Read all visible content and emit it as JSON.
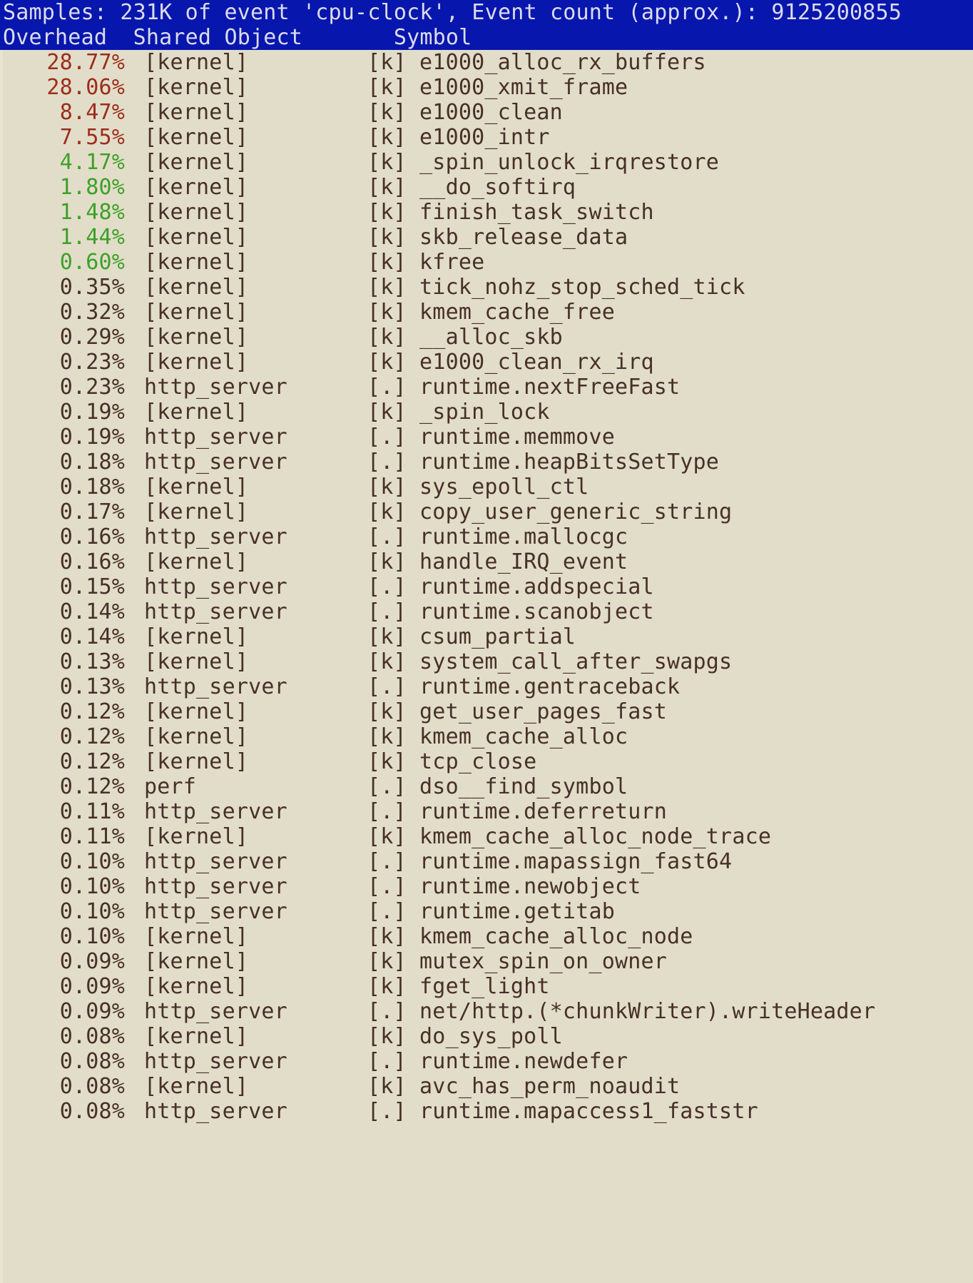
{
  "app": "perf report",
  "colors": {
    "background": "#e2ddc9",
    "foreground": "#473028",
    "header_background": "#0716ad",
    "header_foreground": "#dcdcec",
    "hot": "#9b2d1a",
    "warm": "#3da028"
  },
  "header": {
    "summary": "Samples: 231K of event 'cpu-clock', Event count (approx.): 9125200855",
    "samples": "231K",
    "event": "cpu-clock",
    "event_count": "9125200855",
    "columns": {
      "overhead": "Overhead",
      "shared_object": "Shared Object",
      "symbol": "Symbol"
    },
    "columns_line": "Overhead  Shared Object       Symbol"
  },
  "rows": [
    {
      "overhead": "28.77%",
      "dso": "[kernel]",
      "sym": "[k] e1000_alloc_rx_buffers",
      "heat": "hot"
    },
    {
      "overhead": "28.06%",
      "dso": "[kernel]",
      "sym": "[k] e1000_xmit_frame",
      "heat": "hot"
    },
    {
      "overhead": "8.47%",
      "dso": "[kernel]",
      "sym": "[k] e1000_clean",
      "heat": "hot"
    },
    {
      "overhead": "7.55%",
      "dso": "[kernel]",
      "sym": "[k] e1000_intr",
      "heat": "hot"
    },
    {
      "overhead": "4.17%",
      "dso": "[kernel]",
      "sym": "[k] _spin_unlock_irqrestore",
      "heat": "warm"
    },
    {
      "overhead": "1.80%",
      "dso": "[kernel]",
      "sym": "[k] __do_softirq",
      "heat": "warm"
    },
    {
      "overhead": "1.48%",
      "dso": "[kernel]",
      "sym": "[k] finish_task_switch",
      "heat": "warm"
    },
    {
      "overhead": "1.44%",
      "dso": "[kernel]",
      "sym": "[k] skb_release_data",
      "heat": "warm"
    },
    {
      "overhead": "0.60%",
      "dso": "[kernel]",
      "sym": "[k] kfree",
      "heat": "warm"
    },
    {
      "overhead": "0.35%",
      "dso": "[kernel]",
      "sym": "[k] tick_nohz_stop_sched_tick",
      "heat": "cold"
    },
    {
      "overhead": "0.32%",
      "dso": "[kernel]",
      "sym": "[k] kmem_cache_free",
      "heat": "cold"
    },
    {
      "overhead": "0.29%",
      "dso": "[kernel]",
      "sym": "[k] __alloc_skb",
      "heat": "cold"
    },
    {
      "overhead": "0.23%",
      "dso": "[kernel]",
      "sym": "[k] e1000_clean_rx_irq",
      "heat": "cold"
    },
    {
      "overhead": "0.23%",
      "dso": "http_server",
      "sym": "[.] runtime.nextFreeFast",
      "heat": "cold"
    },
    {
      "overhead": "0.19%",
      "dso": "[kernel]",
      "sym": "[k] _spin_lock",
      "heat": "cold"
    },
    {
      "overhead": "0.19%",
      "dso": "http_server",
      "sym": "[.] runtime.memmove",
      "heat": "cold"
    },
    {
      "overhead": "0.18%",
      "dso": "http_server",
      "sym": "[.] runtime.heapBitsSetType",
      "heat": "cold"
    },
    {
      "overhead": "0.18%",
      "dso": "[kernel]",
      "sym": "[k] sys_epoll_ctl",
      "heat": "cold"
    },
    {
      "overhead": "0.17%",
      "dso": "[kernel]",
      "sym": "[k] copy_user_generic_string",
      "heat": "cold"
    },
    {
      "overhead": "0.16%",
      "dso": "http_server",
      "sym": "[.] runtime.mallocgc",
      "heat": "cold"
    },
    {
      "overhead": "0.16%",
      "dso": "[kernel]",
      "sym": "[k] handle_IRQ_event",
      "heat": "cold"
    },
    {
      "overhead": "0.15%",
      "dso": "http_server",
      "sym": "[.] runtime.addspecial",
      "heat": "cold"
    },
    {
      "overhead": "0.14%",
      "dso": "http_server",
      "sym": "[.] runtime.scanobject",
      "heat": "cold"
    },
    {
      "overhead": "0.14%",
      "dso": "[kernel]",
      "sym": "[k] csum_partial",
      "heat": "cold"
    },
    {
      "overhead": "0.13%",
      "dso": "[kernel]",
      "sym": "[k] system_call_after_swapgs",
      "heat": "cold"
    },
    {
      "overhead": "0.13%",
      "dso": "http_server",
      "sym": "[.] runtime.gentraceback",
      "heat": "cold"
    },
    {
      "overhead": "0.12%",
      "dso": "[kernel]",
      "sym": "[k] get_user_pages_fast",
      "heat": "cold"
    },
    {
      "overhead": "0.12%",
      "dso": "[kernel]",
      "sym": "[k] kmem_cache_alloc",
      "heat": "cold"
    },
    {
      "overhead": "0.12%",
      "dso": "[kernel]",
      "sym": "[k] tcp_close",
      "heat": "cold"
    },
    {
      "overhead": "0.12%",
      "dso": "perf",
      "sym": "[.] dso__find_symbol",
      "heat": "cold"
    },
    {
      "overhead": "0.11%",
      "dso": "http_server",
      "sym": "[.] runtime.deferreturn",
      "heat": "cold"
    },
    {
      "overhead": "0.11%",
      "dso": "[kernel]",
      "sym": "[k] kmem_cache_alloc_node_trace",
      "heat": "cold"
    },
    {
      "overhead": "0.10%",
      "dso": "http_server",
      "sym": "[.] runtime.mapassign_fast64",
      "heat": "cold"
    },
    {
      "overhead": "0.10%",
      "dso": "http_server",
      "sym": "[.] runtime.newobject",
      "heat": "cold"
    },
    {
      "overhead": "0.10%",
      "dso": "http_server",
      "sym": "[.] runtime.getitab",
      "heat": "cold"
    },
    {
      "overhead": "0.10%",
      "dso": "[kernel]",
      "sym": "[k] kmem_cache_alloc_node",
      "heat": "cold"
    },
    {
      "overhead": "0.09%",
      "dso": "[kernel]",
      "sym": "[k] mutex_spin_on_owner",
      "heat": "cold"
    },
    {
      "overhead": "0.09%",
      "dso": "[kernel]",
      "sym": "[k] fget_light",
      "heat": "cold"
    },
    {
      "overhead": "0.09%",
      "dso": "http_server",
      "sym": "[.] net/http.(*chunkWriter).writeHeader",
      "heat": "cold"
    },
    {
      "overhead": "0.08%",
      "dso": "[kernel]",
      "sym": "[k] do_sys_poll",
      "heat": "cold"
    },
    {
      "overhead": "0.08%",
      "dso": "http_server",
      "sym": "[.] runtime.newdefer",
      "heat": "cold"
    },
    {
      "overhead": "0.08%",
      "dso": "[kernel]",
      "sym": "[k] avc_has_perm_noaudit",
      "heat": "cold"
    },
    {
      "overhead": "0.08%",
      "dso": "http_server",
      "sym": "[.] runtime.mapaccess1_faststr",
      "heat": "cold"
    }
  ]
}
